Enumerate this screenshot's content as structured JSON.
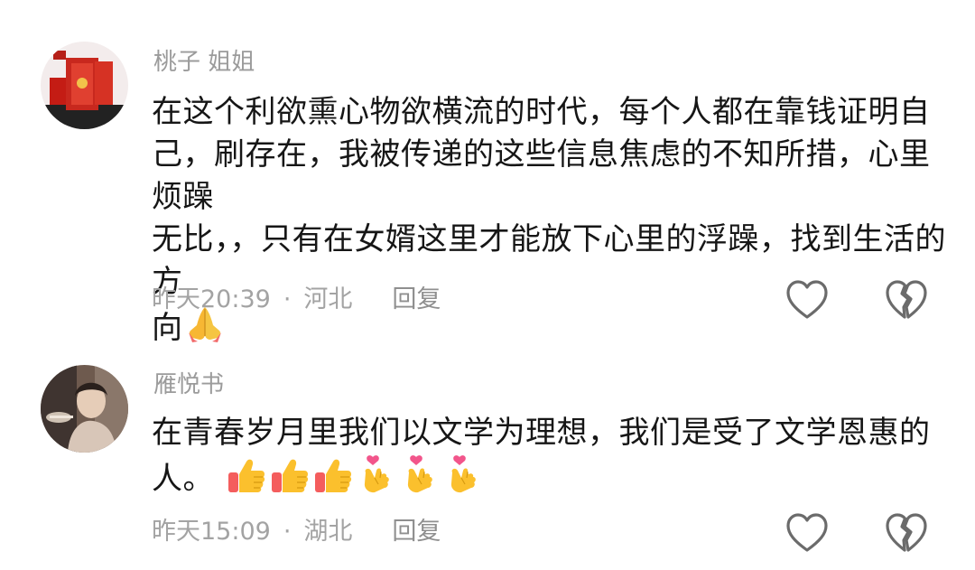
{
  "comments": [
    {
      "username": "桃子 姐姐",
      "text_lines": [
        "在这个利欲熏心物欲横流的时代，每个人都在靠钱证明自",
        "己，刷存在，我被传递的这些信息焦虑的不知所措，心里烦躁",
        "无比，，只有在女婿这里才能放下心里的浮躁，找到生活的方",
        "向"
      ],
      "emojis": [
        "folded-hands"
      ],
      "time": "昨天20:39",
      "separator": "·",
      "location": "河北",
      "reply_label": "回复"
    },
    {
      "username": "雁悦书",
      "text_lines": [
        "在青春岁月里我们以文学为理想，我们是受了文学恩惠的",
        "人。"
      ],
      "emojis": [
        "thumbs-up",
        "thumbs-up",
        "thumbs-up",
        "finger-heart",
        "finger-heart",
        "finger-heart"
      ],
      "time": "昨天15:09",
      "separator": "·",
      "location": "湖北",
      "reply_label": "回复"
    }
  ],
  "colors": {
    "text": "#161616",
    "username": "#9b9b9b",
    "meta": "#a3a3a3",
    "icon_stroke": "#6b6b6b"
  }
}
